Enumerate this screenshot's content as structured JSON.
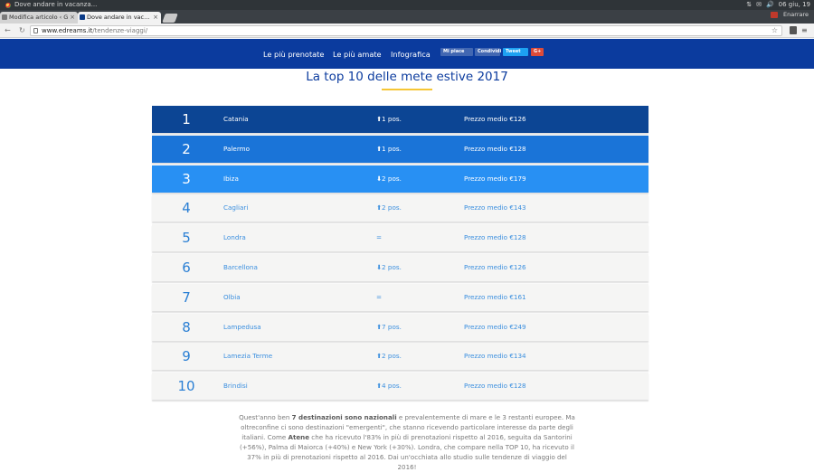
{
  "os": {
    "window_title": "Dove andare in vacanza...",
    "clock": "06 giu, 19",
    "user": "Enarrare"
  },
  "tabs": [
    {
      "label": "Modifica articolo ‹ G"
    },
    {
      "label": "Dove andare in vac…"
    }
  ],
  "address": {
    "host": "www.edreams.it",
    "path": "/tendenze-viaggi/"
  },
  "site_nav": {
    "items": [
      "Le più prenotate",
      "Le più amate",
      "Infografica"
    ],
    "share": {
      "fb_like": "Mi piace",
      "fb_share": "Condividi",
      "tweet": "Tweet",
      "gplus": "G+"
    }
  },
  "title": "La top 10 delle mete estive 2017",
  "ranking": [
    {
      "rank": "1",
      "city": "Catania",
      "trend": "⬆1 pos.",
      "price": "Prezzo medio €126"
    },
    {
      "rank": "2",
      "city": "Palermo",
      "trend": "⬆1 pos.",
      "price": "Prezzo medio €128"
    },
    {
      "rank": "3",
      "city": "Ibiza",
      "trend": "⬇2 pos.",
      "price": "Prezzo medio €179"
    },
    {
      "rank": "4",
      "city": "Cagliari",
      "trend": "⬆2 pos.",
      "price": "Prezzo medio €143"
    },
    {
      "rank": "5",
      "city": "Londra",
      "trend": "=",
      "price": "Prezzo medio €128"
    },
    {
      "rank": "6",
      "city": "Barcellona",
      "trend": "⬇2 pos.",
      "price": "Prezzo medio €126"
    },
    {
      "rank": "7",
      "city": "Olbia",
      "trend": "=",
      "price": "Prezzo medio €161"
    },
    {
      "rank": "8",
      "city": "Lampedusa",
      "trend": "⬆7 pos.",
      "price": "Prezzo medio €249"
    },
    {
      "rank": "9",
      "city": "Lamezia Terme",
      "trend": "⬆2 pos.",
      "price": "Prezzo medio €134"
    },
    {
      "rank": "10",
      "city": "Brindisi",
      "trend": "⬆4 pos.",
      "price": "Prezzo medio €128"
    }
  ],
  "paragraph": {
    "p1": "Quest'anno ben ",
    "b1": "7 destinazioni sono nazionali",
    "p2": " e prevalentemente di mare e le 3 restanti europee. Ma oltreconfine ci sono destinazioni \"emergenti\", che stanno ricevendo particolare interesse da parte degli italiani. Come ",
    "b2": "Atene",
    "p3": " che ha ricevuto l'83% in più di prenotazioni rispetto al 2016, seguita da Santorini (+56%), Palma di Maiorca (+40%) e New York (+30%). Londra, che compare nella TOP 10, ha ricevuto il 37% in più di prenotazioni rispetto al 2016. Dai un'occhiata allo studio sulle tendenze di viaggio del 2016!"
  },
  "colors": {
    "header": "#0b3b9e",
    "row1": "#0c4594",
    "row2": "#1a74d8",
    "row3": "#2890f3",
    "row_plain": "#f5f5f4",
    "accent": "#f6c635"
  }
}
